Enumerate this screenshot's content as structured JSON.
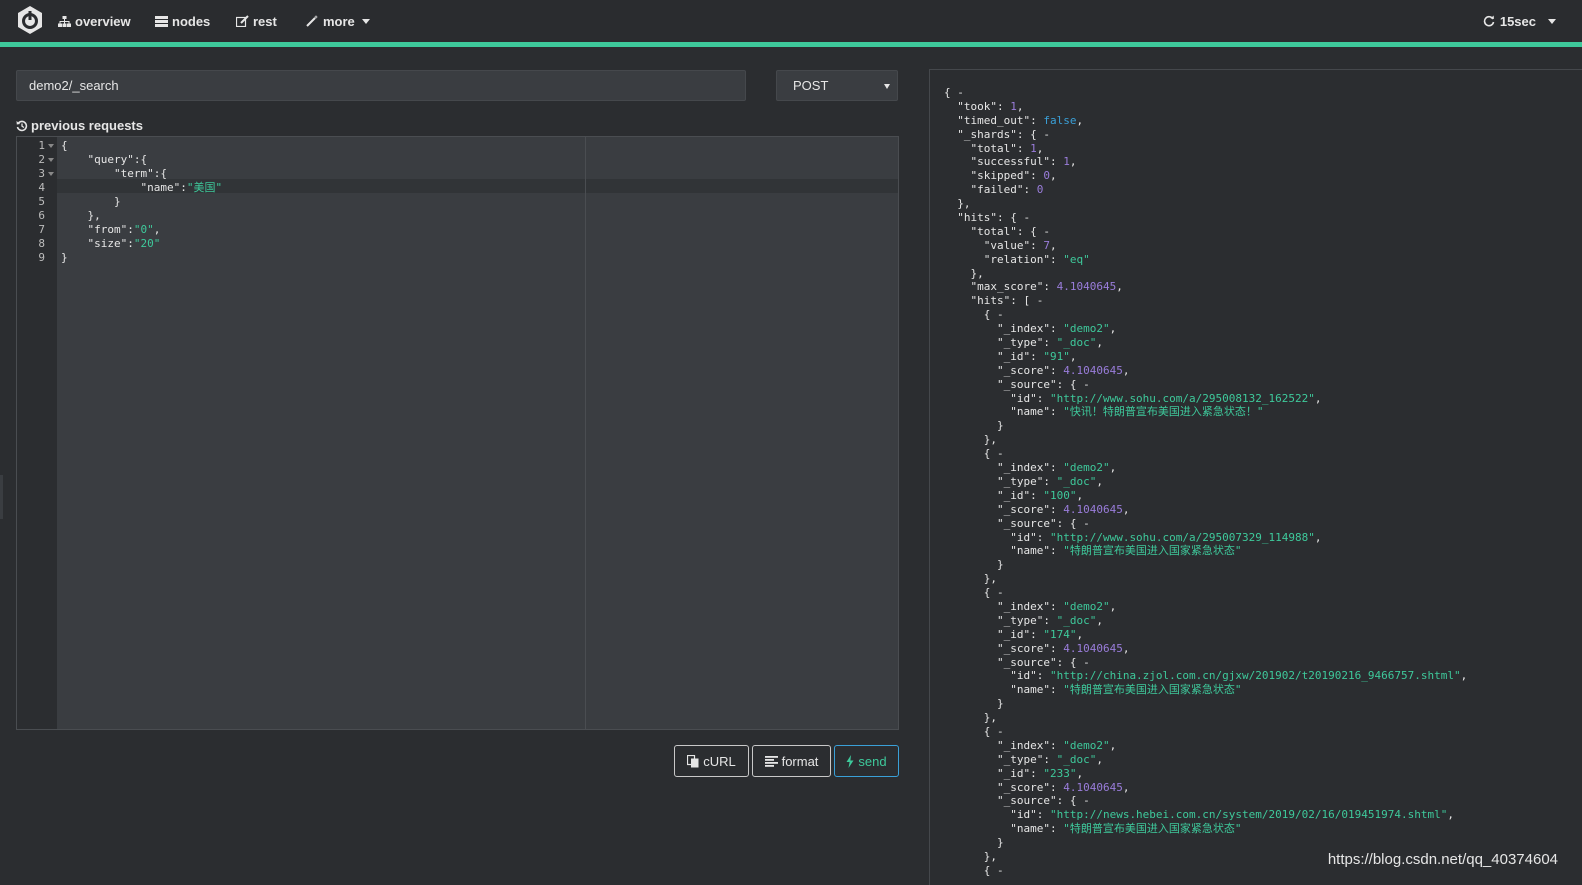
{
  "nav": {
    "overview": "overview",
    "nodes": "nodes",
    "rest": "rest",
    "more": "more",
    "refresh": "15sec"
  },
  "request": {
    "url": "demo2/_search",
    "method": "POST",
    "previous_requests": "previous requests"
  },
  "editor": {
    "lines": [
      {
        "n": "1",
        "fold": true,
        "indent": "",
        "parts": [
          {
            "t": "{",
            "c": ""
          }
        ]
      },
      {
        "n": "2",
        "fold": true,
        "indent": "    ",
        "parts": [
          {
            "t": "\"query\":{",
            "c": ""
          }
        ]
      },
      {
        "n": "3",
        "fold": true,
        "indent": "        ",
        "parts": [
          {
            "t": "\"term\":{",
            "c": ""
          }
        ]
      },
      {
        "n": "4",
        "fold": false,
        "indent": "            ",
        "parts": [
          {
            "t": "\"name\":",
            "c": ""
          },
          {
            "t": "\"美国\"",
            "c": "s"
          }
        ]
      },
      {
        "n": "5",
        "fold": false,
        "indent": "        ",
        "parts": [
          {
            "t": "}",
            "c": ""
          }
        ]
      },
      {
        "n": "6",
        "fold": false,
        "indent": "    ",
        "parts": [
          {
            "t": "},",
            "c": ""
          }
        ]
      },
      {
        "n": "7",
        "fold": false,
        "indent": "    ",
        "parts": [
          {
            "t": "\"from\":",
            "c": ""
          },
          {
            "t": "\"0\"",
            "c": "s"
          },
          {
            "t": ",",
            "c": ""
          }
        ]
      },
      {
        "n": "8",
        "fold": false,
        "indent": "    ",
        "parts": [
          {
            "t": "\"size\":",
            "c": ""
          },
          {
            "t": "\"20\"",
            "c": "s"
          }
        ]
      },
      {
        "n": "9",
        "fold": false,
        "indent": "",
        "parts": [
          {
            "t": "}",
            "c": ""
          }
        ]
      }
    ]
  },
  "buttons": {
    "curl": "cURL",
    "format": "format",
    "send": "send"
  },
  "response": {
    "lines": [
      [
        {
          "t": "{ ",
          "c": "k"
        },
        {
          "t": "-",
          "c": "toggle"
        }
      ],
      [
        {
          "t": "  \"took\": ",
          "c": "k"
        },
        {
          "t": "1",
          "c": "v-n"
        },
        {
          "t": ",",
          "c": "k"
        }
      ],
      [
        {
          "t": "  \"timed_out\": ",
          "c": "k"
        },
        {
          "t": "false",
          "c": "v-b"
        },
        {
          "t": ",",
          "c": "k"
        }
      ],
      [
        {
          "t": "  \"_shards\": { ",
          "c": "k"
        },
        {
          "t": "-",
          "c": "toggle"
        }
      ],
      [
        {
          "t": "    \"total\": ",
          "c": "k"
        },
        {
          "t": "1",
          "c": "v-n"
        },
        {
          "t": ",",
          "c": "k"
        }
      ],
      [
        {
          "t": "    \"successful\": ",
          "c": "k"
        },
        {
          "t": "1",
          "c": "v-n"
        },
        {
          "t": ",",
          "c": "k"
        }
      ],
      [
        {
          "t": "    \"skipped\": ",
          "c": "k"
        },
        {
          "t": "0",
          "c": "v-n"
        },
        {
          "t": ",",
          "c": "k"
        }
      ],
      [
        {
          "t": "    \"failed\": ",
          "c": "k"
        },
        {
          "t": "0",
          "c": "v-n"
        }
      ],
      [
        {
          "t": "  },",
          "c": "k"
        }
      ],
      [
        {
          "t": "  \"hits\": { ",
          "c": "k"
        },
        {
          "t": "-",
          "c": "toggle"
        }
      ],
      [
        {
          "t": "    \"total\": { ",
          "c": "k"
        },
        {
          "t": "-",
          "c": "toggle"
        }
      ],
      [
        {
          "t": "      \"value\": ",
          "c": "k"
        },
        {
          "t": "7",
          "c": "v-n"
        },
        {
          "t": ",",
          "c": "k"
        }
      ],
      [
        {
          "t": "      \"relation\": ",
          "c": "k"
        },
        {
          "t": "\"eq\"",
          "c": "v-s"
        }
      ],
      [
        {
          "t": "    },",
          "c": "k"
        }
      ],
      [
        {
          "t": "    \"max_score\": ",
          "c": "k"
        },
        {
          "t": "4.1040645",
          "c": "v-n"
        },
        {
          "t": ",",
          "c": "k"
        }
      ],
      [
        {
          "t": "    \"hits\": [ ",
          "c": "k"
        },
        {
          "t": "-",
          "c": "toggle"
        }
      ],
      [
        {
          "t": "      { ",
          "c": "k"
        },
        {
          "t": "-",
          "c": "toggle"
        }
      ],
      [
        {
          "t": "        \"_index\": ",
          "c": "k"
        },
        {
          "t": "\"demo2\"",
          "c": "v-s"
        },
        {
          "t": ",",
          "c": "k"
        }
      ],
      [
        {
          "t": "        \"_type\": ",
          "c": "k"
        },
        {
          "t": "\"_doc\"",
          "c": "v-s"
        },
        {
          "t": ",",
          "c": "k"
        }
      ],
      [
        {
          "t": "        \"_id\": ",
          "c": "k"
        },
        {
          "t": "\"91\"",
          "c": "v-s"
        },
        {
          "t": ",",
          "c": "k"
        }
      ],
      [
        {
          "t": "        \"_score\": ",
          "c": "k"
        },
        {
          "t": "4.1040645",
          "c": "v-n"
        },
        {
          "t": ",",
          "c": "k"
        }
      ],
      [
        {
          "t": "        \"_source\": { ",
          "c": "k"
        },
        {
          "t": "-",
          "c": "toggle"
        }
      ],
      [
        {
          "t": "          \"id\": ",
          "c": "k"
        },
        {
          "t": "\"http://www.sohu.com/a/295008132_162522\"",
          "c": "v-s"
        },
        {
          "t": ",",
          "c": "k"
        }
      ],
      [
        {
          "t": "          \"name\": ",
          "c": "k"
        },
        {
          "t": "\"快讯！特朗普宣布美国进入紧急状态！\"",
          "c": "v-s"
        }
      ],
      [
        {
          "t": "        }",
          "c": "k"
        }
      ],
      [
        {
          "t": "      },",
          "c": "k"
        }
      ],
      [
        {
          "t": "      { ",
          "c": "k"
        },
        {
          "t": "-",
          "c": "toggle"
        }
      ],
      [
        {
          "t": "        \"_index\": ",
          "c": "k"
        },
        {
          "t": "\"demo2\"",
          "c": "v-s"
        },
        {
          "t": ",",
          "c": "k"
        }
      ],
      [
        {
          "t": "        \"_type\": ",
          "c": "k"
        },
        {
          "t": "\"_doc\"",
          "c": "v-s"
        },
        {
          "t": ",",
          "c": "k"
        }
      ],
      [
        {
          "t": "        \"_id\": ",
          "c": "k"
        },
        {
          "t": "\"100\"",
          "c": "v-s"
        },
        {
          "t": ",",
          "c": "k"
        }
      ],
      [
        {
          "t": "        \"_score\": ",
          "c": "k"
        },
        {
          "t": "4.1040645",
          "c": "v-n"
        },
        {
          "t": ",",
          "c": "k"
        }
      ],
      [
        {
          "t": "        \"_source\": { ",
          "c": "k"
        },
        {
          "t": "-",
          "c": "toggle"
        }
      ],
      [
        {
          "t": "          \"id\": ",
          "c": "k"
        },
        {
          "t": "\"http://www.sohu.com/a/295007329_114988\"",
          "c": "v-s"
        },
        {
          "t": ",",
          "c": "k"
        }
      ],
      [
        {
          "t": "          \"name\": ",
          "c": "k"
        },
        {
          "t": "\"特朗普宣布美国进入国家紧急状态\"",
          "c": "v-s"
        }
      ],
      [
        {
          "t": "        }",
          "c": "k"
        }
      ],
      [
        {
          "t": "      },",
          "c": "k"
        }
      ],
      [
        {
          "t": "      { ",
          "c": "k"
        },
        {
          "t": "-",
          "c": "toggle"
        }
      ],
      [
        {
          "t": "        \"_index\": ",
          "c": "k"
        },
        {
          "t": "\"demo2\"",
          "c": "v-s"
        },
        {
          "t": ",",
          "c": "k"
        }
      ],
      [
        {
          "t": "        \"_type\": ",
          "c": "k"
        },
        {
          "t": "\"_doc\"",
          "c": "v-s"
        },
        {
          "t": ",",
          "c": "k"
        }
      ],
      [
        {
          "t": "        \"_id\": ",
          "c": "k"
        },
        {
          "t": "\"174\"",
          "c": "v-s"
        },
        {
          "t": ",",
          "c": "k"
        }
      ],
      [
        {
          "t": "        \"_score\": ",
          "c": "k"
        },
        {
          "t": "4.1040645",
          "c": "v-n"
        },
        {
          "t": ",",
          "c": "k"
        }
      ],
      [
        {
          "t": "        \"_source\": { ",
          "c": "k"
        },
        {
          "t": "-",
          "c": "toggle"
        }
      ],
      [
        {
          "t": "          \"id\": ",
          "c": "k"
        },
        {
          "t": "\"http://china.zjol.com.cn/gjxw/201902/t20190216_9466757.shtml\"",
          "c": "v-s"
        },
        {
          "t": ",",
          "c": "k"
        }
      ],
      [
        {
          "t": "          \"name\": ",
          "c": "k"
        },
        {
          "t": "\"特朗普宣布美国进入国家紧急状态\"",
          "c": "v-s"
        }
      ],
      [
        {
          "t": "        }",
          "c": "k"
        }
      ],
      [
        {
          "t": "      },",
          "c": "k"
        }
      ],
      [
        {
          "t": "      { ",
          "c": "k"
        },
        {
          "t": "-",
          "c": "toggle"
        }
      ],
      [
        {
          "t": "        \"_index\": ",
          "c": "k"
        },
        {
          "t": "\"demo2\"",
          "c": "v-s"
        },
        {
          "t": ",",
          "c": "k"
        }
      ],
      [
        {
          "t": "        \"_type\": ",
          "c": "k"
        },
        {
          "t": "\"_doc\"",
          "c": "v-s"
        },
        {
          "t": ",",
          "c": "k"
        }
      ],
      [
        {
          "t": "        \"_id\": ",
          "c": "k"
        },
        {
          "t": "\"233\"",
          "c": "v-s"
        },
        {
          "t": ",",
          "c": "k"
        }
      ],
      [
        {
          "t": "        \"_score\": ",
          "c": "k"
        },
        {
          "t": "4.1040645",
          "c": "v-n"
        },
        {
          "t": ",",
          "c": "k"
        }
      ],
      [
        {
          "t": "        \"_source\": { ",
          "c": "k"
        },
        {
          "t": "-",
          "c": "toggle"
        }
      ],
      [
        {
          "t": "          \"id\": ",
          "c": "k"
        },
        {
          "t": "\"http://news.hebei.com.cn/system/2019/02/16/019451974.shtml\"",
          "c": "v-s"
        },
        {
          "t": ",",
          "c": "k"
        }
      ],
      [
        {
          "t": "          \"name\": ",
          "c": "k"
        },
        {
          "t": "\"特朗普宣布美国进入国家紧急状态\"",
          "c": "v-s"
        }
      ],
      [
        {
          "t": "        }",
          "c": "k"
        }
      ],
      [
        {
          "t": "      },",
          "c": "k"
        }
      ],
      [
        {
          "t": "      { ",
          "c": "k"
        },
        {
          "t": "-",
          "c": "toggle"
        }
      ]
    ]
  },
  "watermark": "https://blog.csdn.net/qq_40374604",
  "colors": {
    "accent": "#3ec99b",
    "background": "#2b2d30",
    "number": "#9a7ddb",
    "boolean": "#3aa0d8"
  }
}
